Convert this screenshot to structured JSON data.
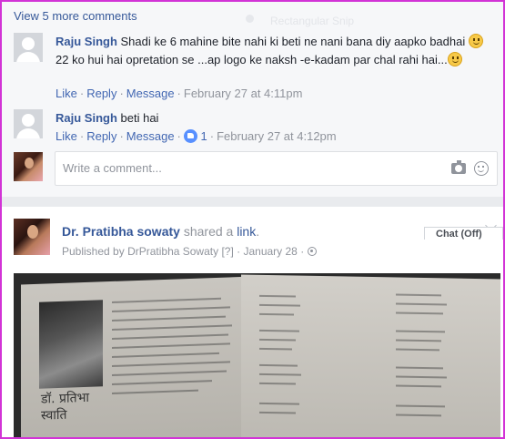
{
  "comments_section": {
    "view_more": "View 5 more comments",
    "watermark_text": "Rectangular Snip"
  },
  "comments": [
    {
      "author": "Raju Singh",
      "text_part1": "Shadi ke 6 mahine bite nahi ki beti ne nani bana diy aapko badhai",
      "text_part2": "22 ko hui hai opretation se ...ap logo ke naksh -e-kadam par chal rahi hai...",
      "like": "Like",
      "reply": "Reply",
      "message": "Message",
      "time": "February 27 at 4:11pm"
    },
    {
      "author": "Raju Singh",
      "text": "beti hai",
      "like": "Like",
      "reply": "Reply",
      "message": "Message",
      "reaction_count": "1",
      "time": "February 27 at 4:12pm"
    }
  ],
  "comment_box": {
    "placeholder": "Write a comment..."
  },
  "post": {
    "author": "Dr. Pratibha sowaty",
    "action": "shared a",
    "link_word": "link",
    "published_prefix": "Published by",
    "published_by": "DrPratibha Sowaty",
    "info_marker": "[?]",
    "date": "January 28",
    "book_caption": "डॉ. प्रतिभा स्वाति"
  },
  "chat": {
    "label": "Chat (Off)"
  }
}
